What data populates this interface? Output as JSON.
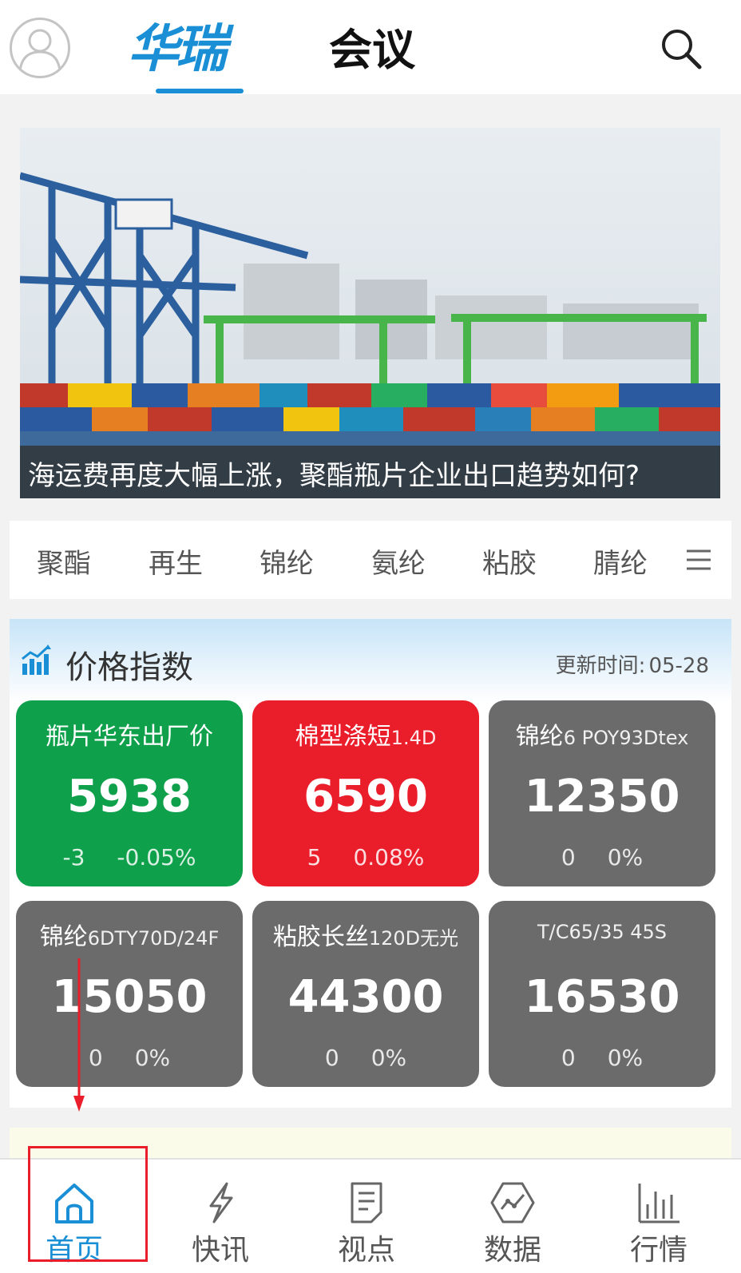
{
  "header": {
    "logo_text": "华瑞",
    "tab_meeting": "会议"
  },
  "banner": {
    "caption": "海运费再度大幅上涨，聚酯瓶片企业出口趋势如何?"
  },
  "categories": [
    "聚酯",
    "再生",
    "锦纶",
    "氨纶",
    "粘胶",
    "腈纶"
  ],
  "price_index": {
    "title": "价格指数",
    "update_label": "更新时间:",
    "update_time": "05-28",
    "cards": [
      {
        "name": "瓶片华东出厂价",
        "sub": "",
        "value": "5938",
        "change": "-3",
        "pct": "-0.05%",
        "color": "#0ea04a"
      },
      {
        "name": "棉型涤短",
        "sub": "1.4D",
        "value": "6590",
        "change": "5",
        "pct": "0.08%",
        "color": "#ea1d2b"
      },
      {
        "name": "锦纶",
        "sub": "6 POY93Dtex",
        "value": "12350",
        "change": "0",
        "pct": "0%",
        "color": "#6b6b6b"
      },
      {
        "name": "锦纶",
        "sub": "6DTY70D/24F",
        "value": "15050",
        "change": "0",
        "pct": "0%",
        "color": "#6b6b6b"
      },
      {
        "name": "粘胶长丝",
        "sub": "120D无光",
        "value": "44300",
        "change": "0",
        "pct": "0%",
        "color": "#6b6b6b"
      },
      {
        "name": "",
        "sub": "T/C65/35 45S",
        "value": "16530",
        "change": "0",
        "pct": "0%",
        "color": "#6b6b6b"
      }
    ]
  },
  "bottom_nav": [
    {
      "label": "首页",
      "icon": "home-icon",
      "active": true
    },
    {
      "label": "快讯",
      "icon": "lightning-icon",
      "active": false
    },
    {
      "label": "视点",
      "icon": "document-icon",
      "active": false
    },
    {
      "label": "数据",
      "icon": "data-chart-icon",
      "active": false
    },
    {
      "label": "行情",
      "icon": "bar-chart-icon",
      "active": false
    }
  ],
  "colors": {
    "accent": "#1a8fd6",
    "up": "#ea1d2b",
    "down": "#0ea04a",
    "neutral": "#6b6b6b"
  }
}
